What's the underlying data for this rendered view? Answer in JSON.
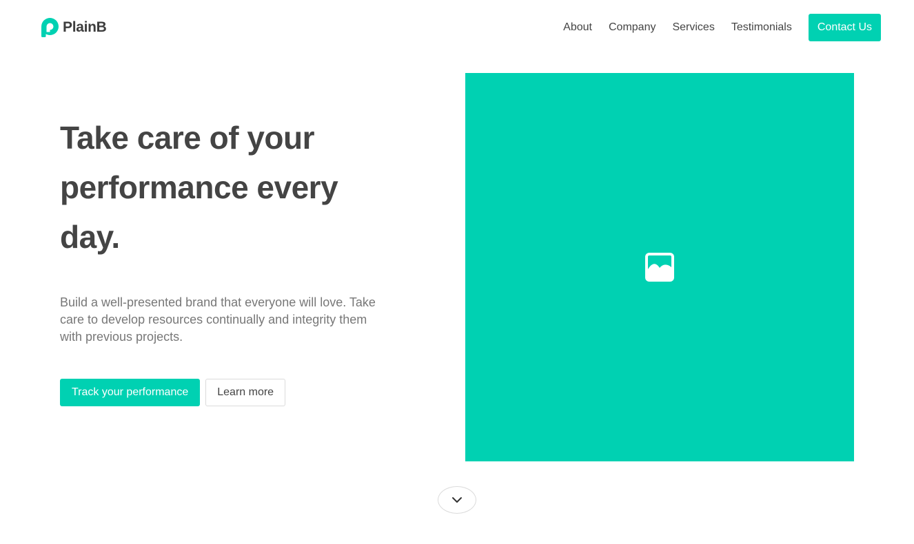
{
  "brand": {
    "name": "PlainB",
    "logo_icon": "p-logo-icon",
    "color": "#00d1b2"
  },
  "nav": {
    "links": [
      {
        "label": "About"
      },
      {
        "label": "Company"
      },
      {
        "label": "Services"
      },
      {
        "label": "Testimonials"
      }
    ],
    "contact_label": "Contact Us"
  },
  "hero": {
    "title": "Take care of your performance every day.",
    "description": "Build a well-presented brand that everyone will love. Take care to develop resources continually and integrity them with previous projects.",
    "primary_button": "Track your performance",
    "secondary_button": "Learn more",
    "image_icon": "image-placeholder-icon",
    "scroll_icon": "chevron-down-icon"
  },
  "colors": {
    "accent": "#00d1b2",
    "text": "#444444",
    "muted_text": "#777777",
    "border": "#dbdbdb"
  }
}
